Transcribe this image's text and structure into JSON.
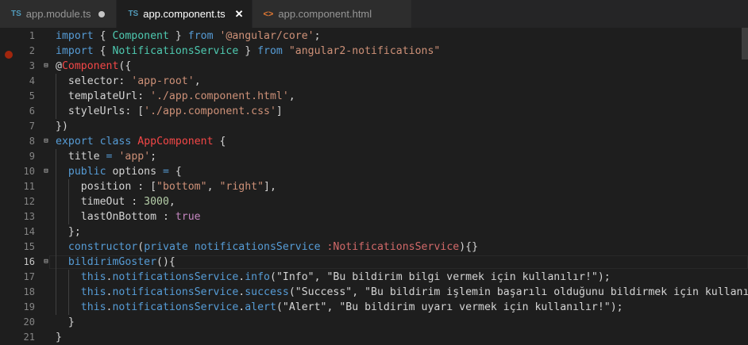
{
  "tabs": [
    {
      "icon": "TS",
      "label": "app.module.ts",
      "state": "modified"
    },
    {
      "icon": "TS",
      "label": "app.component.ts",
      "state": "active"
    },
    {
      "icon": "<>",
      "label": "app.component.html",
      "state": "normal"
    }
  ],
  "lines": [
    {
      "n": "1",
      "tokens": [
        [
          "k",
          "import"
        ],
        [
          "p",
          " { "
        ],
        [
          "t",
          "Component"
        ],
        [
          "p",
          " } "
        ],
        [
          "k",
          "from"
        ],
        [
          "p",
          " "
        ],
        [
          "s",
          "'@angular/core'"
        ],
        [
          "p",
          ";"
        ]
      ]
    },
    {
      "n": "2",
      "tokens": [
        [
          "k",
          "import"
        ],
        [
          "p",
          " { "
        ],
        [
          "t",
          "NotificationsService"
        ],
        [
          "p",
          " } "
        ],
        [
          "k",
          "from"
        ],
        [
          "p",
          " "
        ],
        [
          "s",
          "\"angular2-notifications\""
        ]
      ]
    },
    {
      "n": "3",
      "fold": "⊟",
      "tokens": [
        [
          "p",
          "@"
        ],
        [
          "r",
          "Component"
        ],
        [
          "p",
          "({"
        ]
      ]
    },
    {
      "n": "4",
      "tokens": [
        [
          "p",
          "  selector: "
        ],
        [
          "s",
          "'app-root'"
        ],
        [
          "p",
          ","
        ]
      ]
    },
    {
      "n": "5",
      "tokens": [
        [
          "p",
          "  templateUrl: "
        ],
        [
          "s",
          "'./app.component.html'"
        ],
        [
          "p",
          ","
        ]
      ]
    },
    {
      "n": "6",
      "tokens": [
        [
          "p",
          "  styleUrls: ["
        ],
        [
          "s",
          "'./app.component.css'"
        ],
        [
          "p",
          "]"
        ]
      ]
    },
    {
      "n": "7",
      "tokens": [
        [
          "p",
          "})"
        ]
      ]
    },
    {
      "n": "8",
      "fold": "⊟",
      "tokens": [
        [
          "k",
          "export"
        ],
        [
          "p",
          " "
        ],
        [
          "k",
          "class"
        ],
        [
          "p",
          " "
        ],
        [
          "r",
          "AppComponent"
        ],
        [
          "p",
          " {"
        ]
      ]
    },
    {
      "n": "9",
      "tokens": [
        [
          "p",
          "  title "
        ],
        [
          "k",
          "="
        ],
        [
          "p",
          " "
        ],
        [
          "s",
          "'app'"
        ],
        [
          "p",
          ";"
        ]
      ]
    },
    {
      "n": "10",
      "fold": "⊟",
      "tokens": [
        [
          "p",
          "  "
        ],
        [
          "k",
          "public"
        ],
        [
          "p",
          " options "
        ],
        [
          "k",
          "="
        ],
        [
          "p",
          " {"
        ]
      ]
    },
    {
      "n": "11",
      "tokens": [
        [
          "p",
          "    position : ["
        ],
        [
          "s",
          "\"bottom\""
        ],
        [
          "p",
          ", "
        ],
        [
          "s",
          "\"right\""
        ],
        [
          "p",
          "],"
        ]
      ]
    },
    {
      "n": "12",
      "tokens": [
        [
          "p",
          "    timeOut : "
        ],
        [
          "n",
          "3000"
        ],
        [
          "p",
          ","
        ]
      ]
    },
    {
      "n": "13",
      "tokens": [
        [
          "p",
          "    lastOnBottom : "
        ],
        [
          "m",
          "true"
        ]
      ]
    },
    {
      "n": "14",
      "tokens": [
        [
          "p",
          "  };"
        ]
      ]
    },
    {
      "n": "15",
      "tokens": [
        [
          "p",
          "  "
        ],
        [
          "k",
          "constructor"
        ],
        [
          "p",
          "("
        ],
        [
          "k",
          "private"
        ],
        [
          "p",
          " "
        ],
        [
          "k",
          "notificationsService"
        ],
        [
          "p",
          " "
        ],
        [
          "b",
          ":NotificationsService"
        ],
        [
          "p",
          "){}"
        ]
      ]
    },
    {
      "n": "16",
      "fold": "⊟",
      "tokens": [
        [
          "p",
          "  "
        ],
        [
          "k",
          "bildirimGoster"
        ],
        [
          "p",
          "(){"
        ]
      ]
    },
    {
      "n": "17",
      "tokens": [
        [
          "p",
          "    "
        ],
        [
          "k",
          "this"
        ],
        [
          "p",
          "."
        ],
        [
          "k",
          "notificationsService"
        ],
        [
          "p",
          "."
        ],
        [
          "k",
          "info"
        ],
        [
          "p",
          "(\"Info\", \"Bu bildirim bilgi vermek için kullanılır!\");"
        ]
      ]
    },
    {
      "n": "18",
      "tokens": [
        [
          "p",
          "    "
        ],
        [
          "k",
          "this"
        ],
        [
          "p",
          "."
        ],
        [
          "k",
          "notificationsService"
        ],
        [
          "p",
          "."
        ],
        [
          "k",
          "success"
        ],
        [
          "p",
          "(\"Success\", \"Bu bildirim işlemin başarılı olduğunu bildirmek için kullanılı"
        ]
      ]
    },
    {
      "n": "19",
      "tokens": [
        [
          "p",
          "    "
        ],
        [
          "k",
          "this"
        ],
        [
          "p",
          "."
        ],
        [
          "k",
          "notificationsService"
        ],
        [
          "p",
          "."
        ],
        [
          "k",
          "alert"
        ],
        [
          "p",
          "(\"Alert\", \"Bu bildirim uyarı vermek için kullanılır!\");"
        ]
      ]
    },
    {
      "n": "20",
      "tokens": [
        [
          "p",
          "  }"
        ]
      ]
    },
    {
      "n": "21",
      "tokens": [
        [
          "p",
          "}"
        ]
      ]
    }
  ]
}
